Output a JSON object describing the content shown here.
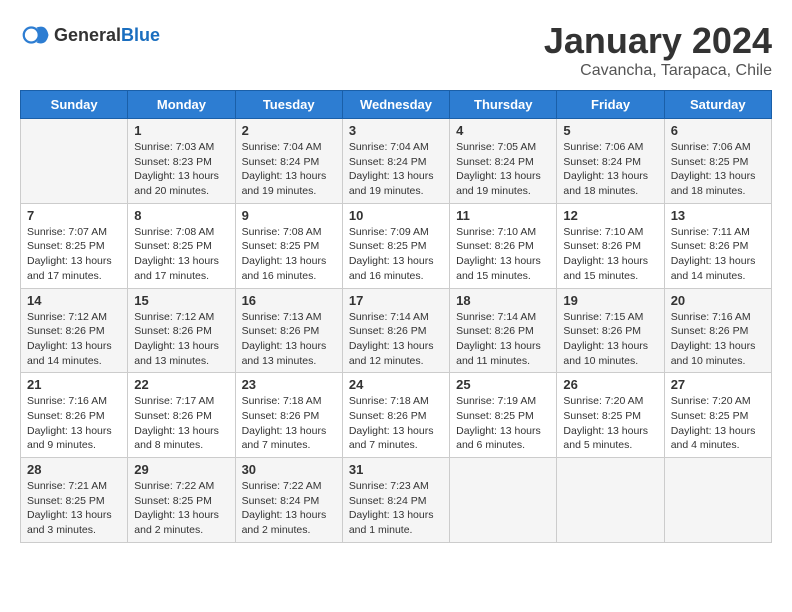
{
  "header": {
    "logo_general": "General",
    "logo_blue": "Blue",
    "month_title": "January 2024",
    "subtitle": "Cavancha, Tarapaca, Chile"
  },
  "days_of_week": [
    "Sunday",
    "Monday",
    "Tuesday",
    "Wednesday",
    "Thursday",
    "Friday",
    "Saturday"
  ],
  "weeks": [
    [
      {
        "day": "",
        "sunrise": "",
        "sunset": "",
        "daylight": ""
      },
      {
        "day": "1",
        "sunrise": "Sunrise: 7:03 AM",
        "sunset": "Sunset: 8:23 PM",
        "daylight": "Daylight: 13 hours and 20 minutes."
      },
      {
        "day": "2",
        "sunrise": "Sunrise: 7:04 AM",
        "sunset": "Sunset: 8:24 PM",
        "daylight": "Daylight: 13 hours and 19 minutes."
      },
      {
        "day": "3",
        "sunrise": "Sunrise: 7:04 AM",
        "sunset": "Sunset: 8:24 PM",
        "daylight": "Daylight: 13 hours and 19 minutes."
      },
      {
        "day": "4",
        "sunrise": "Sunrise: 7:05 AM",
        "sunset": "Sunset: 8:24 PM",
        "daylight": "Daylight: 13 hours and 19 minutes."
      },
      {
        "day": "5",
        "sunrise": "Sunrise: 7:06 AM",
        "sunset": "Sunset: 8:24 PM",
        "daylight": "Daylight: 13 hours and 18 minutes."
      },
      {
        "day": "6",
        "sunrise": "Sunrise: 7:06 AM",
        "sunset": "Sunset: 8:25 PM",
        "daylight": "Daylight: 13 hours and 18 minutes."
      }
    ],
    [
      {
        "day": "7",
        "sunrise": "Sunrise: 7:07 AM",
        "sunset": "Sunset: 8:25 PM",
        "daylight": "Daylight: 13 hours and 17 minutes."
      },
      {
        "day": "8",
        "sunrise": "Sunrise: 7:08 AM",
        "sunset": "Sunset: 8:25 PM",
        "daylight": "Daylight: 13 hours and 17 minutes."
      },
      {
        "day": "9",
        "sunrise": "Sunrise: 7:08 AM",
        "sunset": "Sunset: 8:25 PM",
        "daylight": "Daylight: 13 hours and 16 minutes."
      },
      {
        "day": "10",
        "sunrise": "Sunrise: 7:09 AM",
        "sunset": "Sunset: 8:25 PM",
        "daylight": "Daylight: 13 hours and 16 minutes."
      },
      {
        "day": "11",
        "sunrise": "Sunrise: 7:10 AM",
        "sunset": "Sunset: 8:26 PM",
        "daylight": "Daylight: 13 hours and 15 minutes."
      },
      {
        "day": "12",
        "sunrise": "Sunrise: 7:10 AM",
        "sunset": "Sunset: 8:26 PM",
        "daylight": "Daylight: 13 hours and 15 minutes."
      },
      {
        "day": "13",
        "sunrise": "Sunrise: 7:11 AM",
        "sunset": "Sunset: 8:26 PM",
        "daylight": "Daylight: 13 hours and 14 minutes."
      }
    ],
    [
      {
        "day": "14",
        "sunrise": "Sunrise: 7:12 AM",
        "sunset": "Sunset: 8:26 PM",
        "daylight": "Daylight: 13 hours and 14 minutes."
      },
      {
        "day": "15",
        "sunrise": "Sunrise: 7:12 AM",
        "sunset": "Sunset: 8:26 PM",
        "daylight": "Daylight: 13 hours and 13 minutes."
      },
      {
        "day": "16",
        "sunrise": "Sunrise: 7:13 AM",
        "sunset": "Sunset: 8:26 PM",
        "daylight": "Daylight: 13 hours and 13 minutes."
      },
      {
        "day": "17",
        "sunrise": "Sunrise: 7:14 AM",
        "sunset": "Sunset: 8:26 PM",
        "daylight": "Daylight: 13 hours and 12 minutes."
      },
      {
        "day": "18",
        "sunrise": "Sunrise: 7:14 AM",
        "sunset": "Sunset: 8:26 PM",
        "daylight": "Daylight: 13 hours and 11 minutes."
      },
      {
        "day": "19",
        "sunrise": "Sunrise: 7:15 AM",
        "sunset": "Sunset: 8:26 PM",
        "daylight": "Daylight: 13 hours and 10 minutes."
      },
      {
        "day": "20",
        "sunrise": "Sunrise: 7:16 AM",
        "sunset": "Sunset: 8:26 PM",
        "daylight": "Daylight: 13 hours and 10 minutes."
      }
    ],
    [
      {
        "day": "21",
        "sunrise": "Sunrise: 7:16 AM",
        "sunset": "Sunset: 8:26 PM",
        "daylight": "Daylight: 13 hours and 9 minutes."
      },
      {
        "day": "22",
        "sunrise": "Sunrise: 7:17 AM",
        "sunset": "Sunset: 8:26 PM",
        "daylight": "Daylight: 13 hours and 8 minutes."
      },
      {
        "day": "23",
        "sunrise": "Sunrise: 7:18 AM",
        "sunset": "Sunset: 8:26 PM",
        "daylight": "Daylight: 13 hours and 7 minutes."
      },
      {
        "day": "24",
        "sunrise": "Sunrise: 7:18 AM",
        "sunset": "Sunset: 8:26 PM",
        "daylight": "Daylight: 13 hours and 7 minutes."
      },
      {
        "day": "25",
        "sunrise": "Sunrise: 7:19 AM",
        "sunset": "Sunset: 8:25 PM",
        "daylight": "Daylight: 13 hours and 6 minutes."
      },
      {
        "day": "26",
        "sunrise": "Sunrise: 7:20 AM",
        "sunset": "Sunset: 8:25 PM",
        "daylight": "Daylight: 13 hours and 5 minutes."
      },
      {
        "day": "27",
        "sunrise": "Sunrise: 7:20 AM",
        "sunset": "Sunset: 8:25 PM",
        "daylight": "Daylight: 13 hours and 4 minutes."
      }
    ],
    [
      {
        "day": "28",
        "sunrise": "Sunrise: 7:21 AM",
        "sunset": "Sunset: 8:25 PM",
        "daylight": "Daylight: 13 hours and 3 minutes."
      },
      {
        "day": "29",
        "sunrise": "Sunrise: 7:22 AM",
        "sunset": "Sunset: 8:25 PM",
        "daylight": "Daylight: 13 hours and 2 minutes."
      },
      {
        "day": "30",
        "sunrise": "Sunrise: 7:22 AM",
        "sunset": "Sunset: 8:24 PM",
        "daylight": "Daylight: 13 hours and 2 minutes."
      },
      {
        "day": "31",
        "sunrise": "Sunrise: 7:23 AM",
        "sunset": "Sunset: 8:24 PM",
        "daylight": "Daylight: 13 hours and 1 minute."
      },
      {
        "day": "",
        "sunrise": "",
        "sunset": "",
        "daylight": ""
      },
      {
        "day": "",
        "sunrise": "",
        "sunset": "",
        "daylight": ""
      },
      {
        "day": "",
        "sunrise": "",
        "sunset": "",
        "daylight": ""
      }
    ]
  ]
}
